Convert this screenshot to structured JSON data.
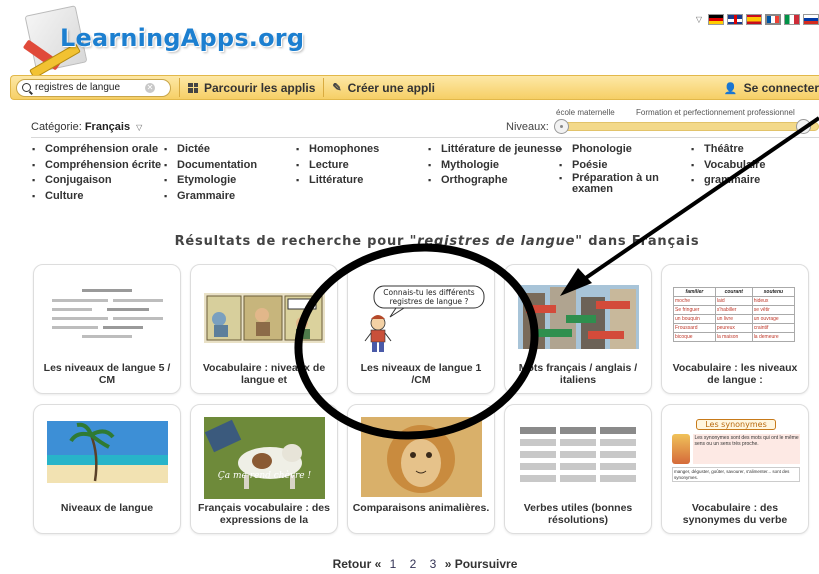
{
  "header": {
    "logo_text": "LearningApps.org",
    "languages": [
      "de",
      "en",
      "es",
      "fr",
      "it",
      "ru"
    ]
  },
  "toolbar": {
    "search_value": "registres de langue",
    "browse_label": "Parcourir les applis",
    "create_label": "Créer une appli",
    "connect_label": "Se connecter"
  },
  "filters": {
    "category_prefix": "Catégorie:",
    "category_value": "Français",
    "levels_label": "Niveaux:",
    "level_min_label": "école maternelle",
    "level_max_label": "Formation et perfectionnement professionnel"
  },
  "subjects": {
    "col1": [
      "Compréhension orale",
      "Compréhension écrite",
      "Conjugaison",
      "Culture"
    ],
    "col2": [
      "Dictée",
      "Documentation",
      "Etymologie",
      "Grammaire"
    ],
    "col3": [
      "Homophones",
      "Lecture",
      "Littérature"
    ],
    "col4": [
      "Littérature de jeunesse",
      "Mythologie",
      "Orthographe"
    ],
    "col5": [
      "Phonologie",
      "Poésie",
      "Préparation à un examen"
    ],
    "col6": [
      "Théâtre",
      "Vocabulaire",
      "grammaire"
    ]
  },
  "results": {
    "prefix": "Résultats de recherche pour ",
    "query": "\"registres de langue\"",
    "suffix": " dans Français"
  },
  "cards": [
    {
      "title": "Les niveaux de langue 5 / CM",
      "thumb": "lines"
    },
    {
      "title": "Vocabulaire : niveaux de langue et",
      "thumb": "comic"
    },
    {
      "title": "Les niveaux de langue 1 /CM",
      "thumb": "cartoon",
      "bubble": "Connais-tu les différents registres de langue ?"
    },
    {
      "title": "Mots français / anglais / italiens",
      "thumb": "buildings"
    },
    {
      "title": "Vocabulaire : les niveaux de langue :",
      "thumb": "table",
      "table_headers": [
        "familier",
        "courant",
        "soutenu"
      ],
      "table_rows": [
        [
          "moche",
          "laid",
          "hideux"
        ],
        [
          "Se fringuer",
          "s'habiller",
          "se vêtir"
        ],
        [
          "un bouquin",
          "un livre",
          "un ouvrage"
        ],
        [
          "Froussard",
          "peureux",
          "craintif"
        ],
        [
          "bicoque",
          "la maison",
          "la demeure"
        ]
      ]
    },
    {
      "title": "Niveaux de langue",
      "thumb": "beach"
    },
    {
      "title": "Français vocabulaire : des expressions de la",
      "thumb": "goat",
      "caption": "Ça me rend chèvre !"
    },
    {
      "title": "Comparaisons animalières.",
      "thumb": "lion"
    },
    {
      "title": "Verbes utiles (bonnes résolutions)",
      "thumb": "grid"
    },
    {
      "title": "Vocabulaire : des synonymes du verbe",
      "thumb": "synonyms",
      "syn_title": "Les synonymes",
      "syn_text": "Les synonymes sont des mots qui ont le même sens ou un sens très proche.",
      "syn_examples": "manger, déguster, goûter, savourer, s'alimenter... sont des synonymes."
    }
  ],
  "pagination": {
    "prev": "Retour «",
    "pages": [
      "1",
      "2",
      "3"
    ],
    "next": "» Poursuivre"
  },
  "colors": {
    "toolbar": "#f6cf66",
    "logo": "#1c7fd0",
    "annotation": "#000000"
  }
}
